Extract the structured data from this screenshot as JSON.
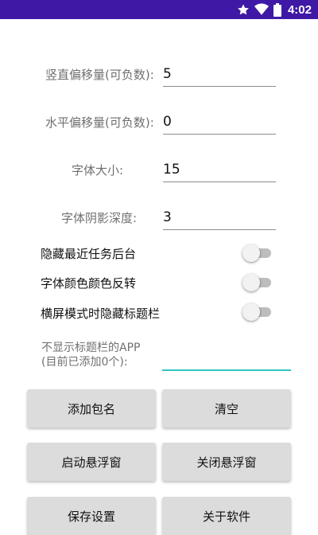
{
  "status_bar": {
    "time": "4:02",
    "icons": [
      "star-icon",
      "wifi-icon",
      "battery-icon"
    ],
    "background": "#3f19a6"
  },
  "settings": {
    "vertical_offset": {
      "label": "竖直偏移量(可负数):",
      "value": "5"
    },
    "horizontal_offset": {
      "label": "水平偏移量(可负数):",
      "value": "0"
    },
    "font_size": {
      "label": "字体大小:",
      "value": "15"
    },
    "shadow_depth": {
      "label": "字体阴影深度:",
      "value": "3"
    }
  },
  "switches": {
    "hide_recents": {
      "label": "隐藏最近任务后台",
      "on": false
    },
    "invert_color": {
      "label": "字体颜色颜色反转",
      "on": false
    },
    "hide_titlebar_landscape": {
      "label": "横屏模式时隐藏标题栏",
      "on": false
    }
  },
  "app_list": {
    "line1": "不显示标题栏的APP",
    "line2": "(目前已添加0个):",
    "input_value": ""
  },
  "buttons": {
    "add_package": "添加包名",
    "clear": "清空",
    "start_float": "启动悬浮窗",
    "stop_float": "关闭悬浮窗",
    "save": "保存设置",
    "about": "关于软件"
  },
  "colors": {
    "accent": "#2ec4c0",
    "button_bg": "#dcdcdc"
  }
}
